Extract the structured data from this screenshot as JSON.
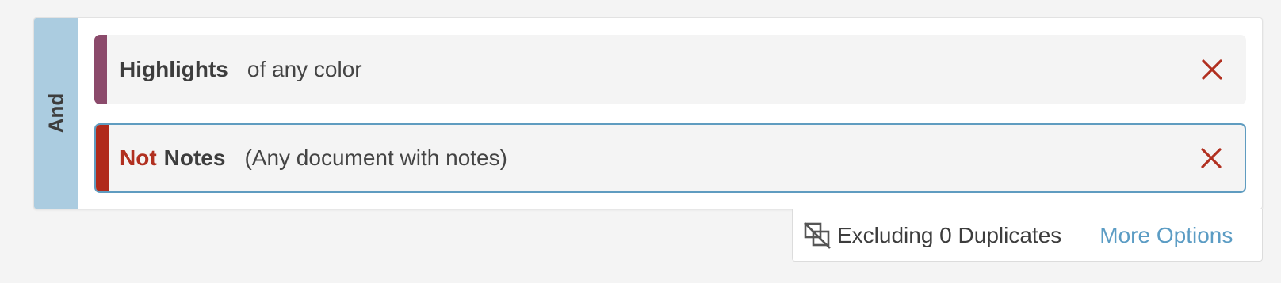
{
  "group": {
    "operator_label": "And",
    "bar_color": "#abcce0"
  },
  "rules": [
    {
      "negated": false,
      "field": "Highlights",
      "description": "of any color",
      "accent_color": "#8b4a6b",
      "remove_icon": "close-icon"
    },
    {
      "negated": true,
      "not_label": "Not",
      "field": "Notes",
      "description": "(Any document with notes)",
      "accent_color": "#b02a1b",
      "remove_icon": "close-icon"
    }
  ],
  "footer": {
    "duplicates_icon": "exclude-duplicates-icon",
    "duplicates_text": "Excluding 0 Duplicates",
    "more_options_label": "More Options",
    "link_color": "#5b9cc4"
  },
  "colors": {
    "remove_x": "#b13020",
    "selected_border": "#5f9cc0"
  }
}
